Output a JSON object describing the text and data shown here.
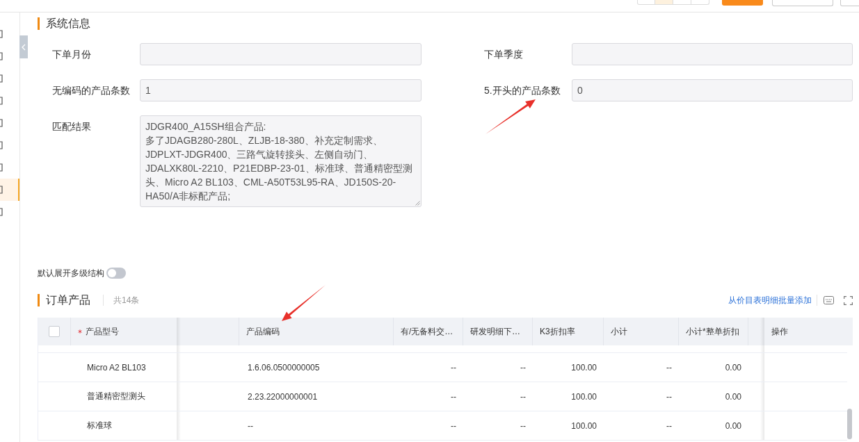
{
  "top_bar": {
    "segments": [
      {
        "selected": false
      },
      {
        "selected": true
      },
      {
        "selected": false
      },
      {
        "selected": false
      }
    ],
    "buttons": [
      {
        "kind": "primary"
      },
      {
        "kind": "default"
      },
      {
        "kind": "default"
      }
    ]
  },
  "sidebar": {
    "items": [
      {
        "selected": false
      },
      {
        "selected": false
      },
      {
        "selected": false
      },
      {
        "selected": false
      },
      {
        "selected": false
      },
      {
        "selected": false
      },
      {
        "selected": false
      },
      {
        "selected": true
      },
      {
        "selected": false
      }
    ]
  },
  "system_info": {
    "title": "系统信息",
    "fields": [
      {
        "label": "下单月份",
        "kind": "input"
      },
      {
        "label": "下单季度",
        "kind": "input"
      },
      {
        "label": "无编码的产品条数",
        "kind": "input",
        "value": "1"
      },
      {
        "label": "5.开头的产品条数",
        "kind": "input",
        "value": "0"
      },
      {
        "label": "匹配结果",
        "kind": "textarea",
        "value": "JDGR400_A15SH组合产品:\n多了JDAGB280-280L、ZLJB-18-380、补充定制需求、JDPLXT-JDGR400、三路气旋转接头、左侧自动门、JDALXK80L-2210、P21EDBP-23-01、标准球、普通精密型测头、Micro A2 BL103、CML-A50T53L95-RA、JD150S-20-HA50/A非标配产品;"
      }
    ]
  },
  "expand_toggle": {
    "label": "默认展开多级结构",
    "on": false
  },
  "order_products": {
    "title": "订单产品",
    "count": "共14条",
    "batch_add_link": "从价目表明细批量添加",
    "table": {
      "select_all": {
        "checked": false
      },
      "columns": [
        {
          "label": "产品型号",
          "kind": "model",
          "required": true
        },
        {
          "kind": "blank"
        },
        {
          "label": "产品编码",
          "kind": "code"
        },
        {
          "label": "有/无备料交…",
          "kind": "number"
        },
        {
          "label": "研发明细下…",
          "kind": "number"
        },
        {
          "label": "K3折扣率",
          "kind": "number"
        },
        {
          "label": "小计",
          "kind": "number"
        },
        {
          "label": "小计*整单折扣",
          "kind": "number"
        },
        {
          "kind": "cut"
        },
        {
          "label": "操作",
          "kind": "action"
        }
      ],
      "rows": [
        {
          "cells": [
            "Micro A2 BL103",
            "",
            "1.6.06.0500000005",
            "--",
            "--",
            "100.00",
            "--",
            "0.00",
            "",
            ""
          ]
        },
        {
          "cells": [
            "普通精密型测头",
            "",
            "2.23.22000000001",
            "--",
            "--",
            "100.00",
            "--",
            "0.00",
            "",
            ""
          ]
        },
        {
          "cells": [
            "标准球",
            "",
            "--",
            "--",
            "--",
            "100.00",
            "--",
            "0.00",
            "",
            ""
          ]
        }
      ]
    }
  },
  "annotations": [
    {
      "kind": "arrow"
    },
    {
      "kind": "arrow"
    }
  ]
}
